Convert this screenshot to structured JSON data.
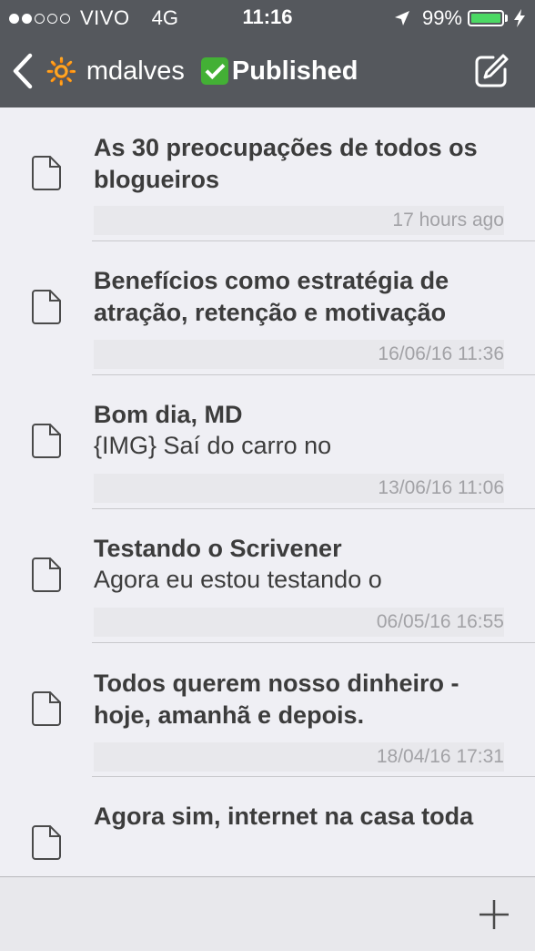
{
  "status_bar": {
    "signal_filled": 2,
    "signal_total": 5,
    "carrier": "VIVO",
    "network": "4G",
    "time": "11:16",
    "battery_text": "99%",
    "battery_level": 0.99,
    "battery_color": "#4cd964",
    "location_icon": "location-arrow-icon",
    "charging_icon": "bolt-icon"
  },
  "nav": {
    "back_icon": "chevron-left-icon",
    "sun_emoji": "🔆",
    "user": "mdalves",
    "published_icon": "check-mark-button-icon",
    "status": "Published",
    "compose_icon": "compose-icon"
  },
  "documents": [
    {
      "title": "As 30 preocupações de todos os blogueiros",
      "excerpt": "",
      "date": "17 hours ago"
    },
    {
      "title": "Benefícios como estratégia de atração, retenção e motivação",
      "excerpt": "",
      "date": "16/06/16 11:36"
    },
    {
      "title": "Bom dia, MD",
      "excerpt": "{IMG} Saí do carro no",
      "date": "13/06/16 11:06"
    },
    {
      "title": "Testando o Scrivener",
      "excerpt": "Agora eu estou testando o",
      "date": "06/05/16 16:55"
    },
    {
      "title": "Todos querem nosso dinheiro - hoje, amanhã e depois.",
      "excerpt": "",
      "date": "18/04/16 17:31"
    },
    {
      "title": "Agora sim, internet na casa toda",
      "excerpt": "",
      "date": ""
    }
  ],
  "toolbar": {
    "add_icon": "plus-icon"
  },
  "colors": {
    "header_bg": "#55585d",
    "list_bg": "#efeff4",
    "accent_check": "#43b035"
  }
}
